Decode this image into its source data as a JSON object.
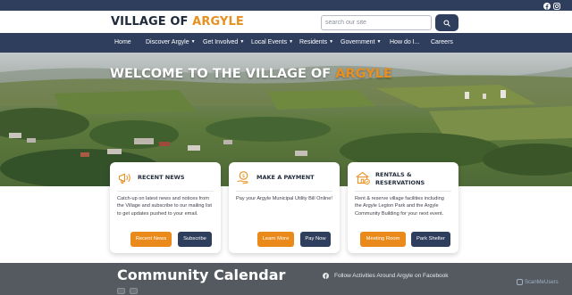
{
  "header": {
    "logo_main": "VILLAGE OF ",
    "logo_accent": "ARGYLE",
    "search_placeholder": "search our site"
  },
  "social": [
    {
      "icon": "facebook-icon"
    },
    {
      "icon": "instagram-icon"
    }
  ],
  "nav": {
    "items": [
      {
        "label": "Home",
        "dropdown": false
      },
      {
        "label": "Discover Argyle",
        "dropdown": true
      },
      {
        "label": "Get Involved",
        "dropdown": true
      },
      {
        "label": "Local Events",
        "dropdown": true
      },
      {
        "label": "Residents",
        "dropdown": true
      },
      {
        "label": "Government",
        "dropdown": true
      },
      {
        "label": "How do I...",
        "dropdown": false
      },
      {
        "label": "Careers",
        "dropdown": false
      }
    ]
  },
  "hero": {
    "title_main": "WELCOME TO THE VILLAGE OF ",
    "title_accent": "ARGYLE"
  },
  "cards": [
    {
      "icon": "megaphone-icon",
      "title": "RECENT NEWS",
      "text": "Catch-up on latest news and notices from the Village and subscribe to our mailing list to get updates pushed to your email.",
      "buttons": [
        "Recent News",
        "Subscribe"
      ]
    },
    {
      "icon": "coin-hand-icon",
      "title": "MAKE A PAYMENT",
      "text": "Pay your Argyle Municipal Utility Bill Online!",
      "buttons": [
        "Learn More",
        "Pay Now"
      ]
    },
    {
      "icon": "building-icon",
      "title_line1": "RENTALS &",
      "title_line2": "RESERVATIONS",
      "text": "Rent & reserve village facilities including the Argyle Legion Park and the Argyle Community Building for your next event.",
      "buttons": [
        "Meeting Room",
        "Park Shelter"
      ]
    }
  ],
  "calendar": {
    "title": "Community Calendar",
    "facebook_link": "Follow Activities Around Argyle on Facebook"
  },
  "watermark": "ScanMeUsers",
  "colors": {
    "navy": "#2f3e5c",
    "accent_orange": "#e8901f",
    "footer_gray": "#545a5f"
  }
}
